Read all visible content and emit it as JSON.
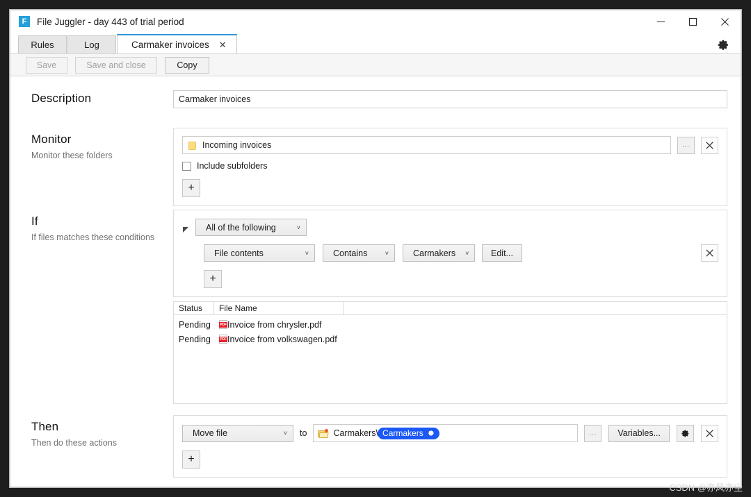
{
  "window": {
    "title": "File Juggler - day 443 of trial period",
    "app_icon": "F",
    "icon_names": {
      "minimize": "minimize-icon",
      "maximize": "maximize-icon",
      "close": "close-icon",
      "settings": "gear-icon"
    }
  },
  "tabs": [
    {
      "label": "Rules",
      "active": false,
      "closable": false
    },
    {
      "label": "Log",
      "active": false,
      "closable": false
    },
    {
      "label": "Carmaker invoices",
      "active": true,
      "closable": true,
      "close_glyph": "✕"
    }
  ],
  "toolbar": {
    "save_label": "Save",
    "save_and_close_label": "Save and close",
    "copy_label": "Copy"
  },
  "description": {
    "title": "Description",
    "value": "Carmaker invoices",
    "placeholder": ""
  },
  "monitor": {
    "title": "Monitor",
    "subtitle": "Monitor these folders",
    "folder_value": "Incoming invoices",
    "browse_label": "...",
    "remove_label": "✕",
    "include_subfolders_label": "Include subfolders",
    "include_subfolders_checked": false,
    "add_label": "+"
  },
  "if": {
    "title": "If",
    "subtitle": "If files matches these conditions",
    "match_mode": "All of the following",
    "condition": {
      "field": "File contents",
      "operator": "Contains",
      "value": "Carmakers",
      "edit_label": "Edit..."
    },
    "remove_label": "✕",
    "add_label": "+",
    "caret": "˅"
  },
  "filelist": {
    "columns": [
      "Status",
      "File Name",
      ""
    ],
    "rows": [
      {
        "status": "Pending",
        "name": "Invoice from chrysler.pdf",
        "icon": "pdf-file-icon",
        "icon_label": "PDF"
      },
      {
        "status": "Pending",
        "name": "Invoice from volkswagen.pdf",
        "icon": "pdf-file-icon",
        "icon_label": "PDF"
      }
    ]
  },
  "then": {
    "title": "Then",
    "subtitle": "Then do these actions",
    "action": "Move file",
    "to_label": "to",
    "destination_prefix": "Carmakers\\",
    "destination_token": "Carmakers",
    "browse_label": "...",
    "variables_label": "Variables...",
    "settings_label": "gear-icon",
    "remove_label": "✕",
    "add_label": "+"
  },
  "watermark": "CSDN @亦风亦尘",
  "colors": {
    "accent_tab": "#2f96d8",
    "app_icon_bg": "#26a0da",
    "token_bg": "#1b58f5",
    "pdf_red": "#e8202a",
    "folder_yellow": "#fbdd7e",
    "toolbar_bg": "#f6f6f6"
  }
}
